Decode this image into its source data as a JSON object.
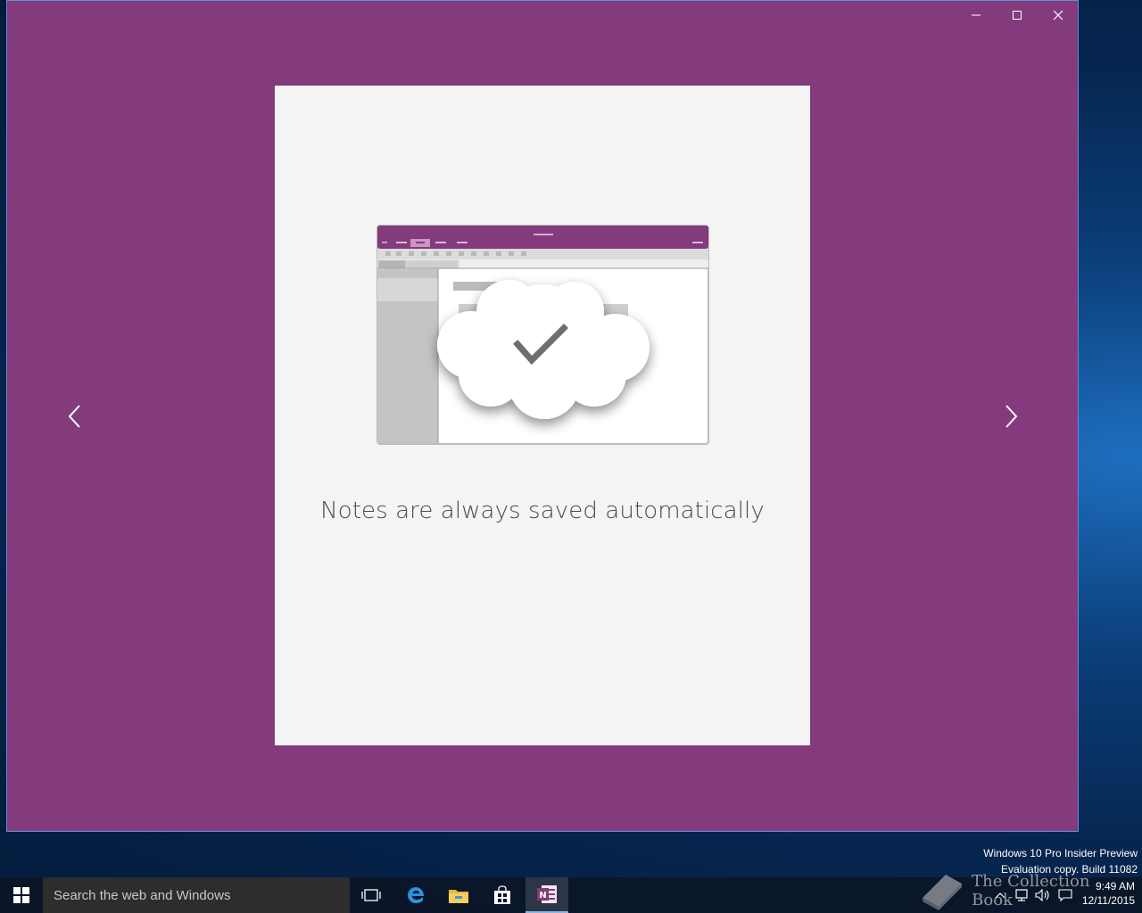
{
  "window": {
    "background": "#833b7d",
    "controls": {
      "minimize": "minimize",
      "maximize": "maximize",
      "close": "close"
    }
  },
  "slide": {
    "caption": "Notes are always saved automatically",
    "illustration_icon": "onenote-cloud-saved-icon"
  },
  "navigation": {
    "previous_icon": "chevron-left-icon",
    "next_icon": "chevron-right-icon"
  },
  "watermark": {
    "line1": "Windows 10 Pro Insider Preview",
    "line2": "Evaluation copy. Build 11082"
  },
  "taskbar": {
    "search_placeholder": "Search the web and Windows",
    "pinned": [
      "task-view",
      "edge",
      "file-explorer",
      "store",
      "onenote"
    ],
    "active_app": "onenote",
    "time": "9:49 AM",
    "date": "12/11/2015"
  },
  "brand_logo_text": "The Collection Book",
  "colors": {
    "accent_purple": "#833b7d",
    "card_bg": "#f4f4f4",
    "taskbar": "#0a1628"
  }
}
